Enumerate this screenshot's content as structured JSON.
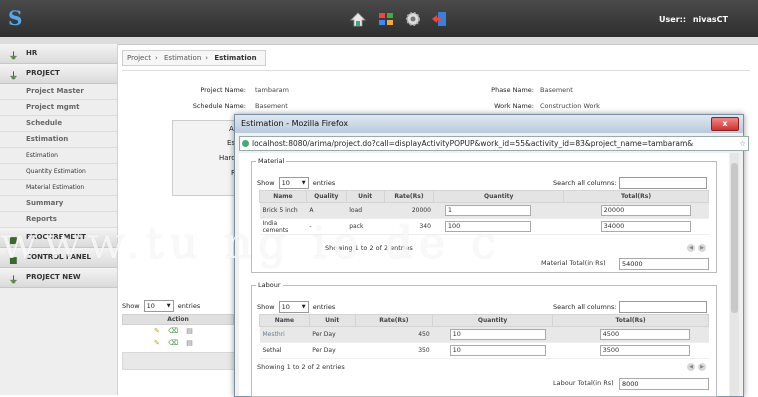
{
  "header": {
    "logo_text": "S",
    "user_label": "User::",
    "user_name": "nivasCT",
    "icons": [
      "home-icon",
      "org-chart-icon",
      "gear-icon",
      "logout-icon"
    ]
  },
  "sidebar": {
    "sections": [
      {
        "label": "HR"
      },
      {
        "label": "PROJECT",
        "items": [
          {
            "label": "Project Master",
            "style": "bold"
          },
          {
            "label": "Project mgmt",
            "style": "bold"
          },
          {
            "label": "Schedule",
            "style": "bold"
          },
          {
            "label": "Estimation",
            "style": "bold"
          },
          {
            "label": "Estimation",
            "style": "plain"
          },
          {
            "label": "Quantity Estimation",
            "style": "plain"
          },
          {
            "label": "Material Estimation",
            "style": "plain"
          },
          {
            "label": "Summary",
            "style": "bold"
          },
          {
            "label": "Reports",
            "style": "bold"
          }
        ]
      },
      {
        "label": "PROCUREMENT"
      },
      {
        "label": "CONTROL PANEL"
      },
      {
        "label": "PROJECT NEW"
      }
    ]
  },
  "breadcrumb": [
    "Project",
    "Estimation",
    "Estimation"
  ],
  "form": {
    "project_name_label": "Project Name:",
    "project_name": "tambaram",
    "phase_name_label": "Phase Name:",
    "phase_name": "Basement",
    "schedule_name_label": "Schedule Name:",
    "schedule_name": "Basement",
    "work_name_label": "Work Name:",
    "work_name": "Construction Work",
    "partial_labels": [
      "A",
      "Es",
      "Hard",
      "R"
    ]
  },
  "main_grid": {
    "show_label": "Show",
    "show_value": "10",
    "entries_label": "entries",
    "action_header": "Action",
    "row_count": 2
  },
  "watermark": "www.tu  ng  io  de  c",
  "popup": {
    "title": "Estimation - Mozilla Firefox",
    "close_label": "x",
    "url": "localhost:8080/arima/project.do?call=displayActivityPOPUP&work_id=55&activity_id=83&project_name=tambaram&",
    "material": {
      "legend": "Material",
      "show_label": "Show",
      "show_value": "10",
      "entries_label": "entries",
      "search_label": "Search all columns:",
      "headers": [
        "Name",
        "Quality",
        "Unit",
        "Rate(Rs)",
        "Quantity",
        "Total(Rs)"
      ],
      "rows": [
        {
          "name": "Brick 5 inch",
          "quality": "A",
          "unit": "load",
          "rate": "20000",
          "quantity": "1",
          "total": "20000"
        },
        {
          "name": "India cements",
          "quality": "-",
          "unit": "pack",
          "rate": "340",
          "quantity": "100",
          "total": "34000"
        }
      ],
      "info": "Showing 1 to 2 of 2 entries",
      "total_label": "Material Total(in Rs)",
      "total_value": "54000"
    },
    "labour": {
      "legend": "Labour",
      "show_label": "Show",
      "show_value": "10",
      "entries_label": "entries",
      "search_label": "Search all columns:",
      "headers": [
        "Name",
        "Unit",
        "Rate(Rs)",
        "Quantity",
        "Total(Rs)"
      ],
      "rows": [
        {
          "name": "Mesthri",
          "unit": "Per Day",
          "rate": "450",
          "quantity": "10",
          "total": "4500"
        },
        {
          "name": "Sethal",
          "unit": "Per Day",
          "rate": "350",
          "quantity": "10",
          "total": "3500"
        }
      ],
      "info": "Showing 1 to 2 of 2 entries",
      "total_label": "Labour Total(in Rs)",
      "total_value": "8000"
    }
  }
}
